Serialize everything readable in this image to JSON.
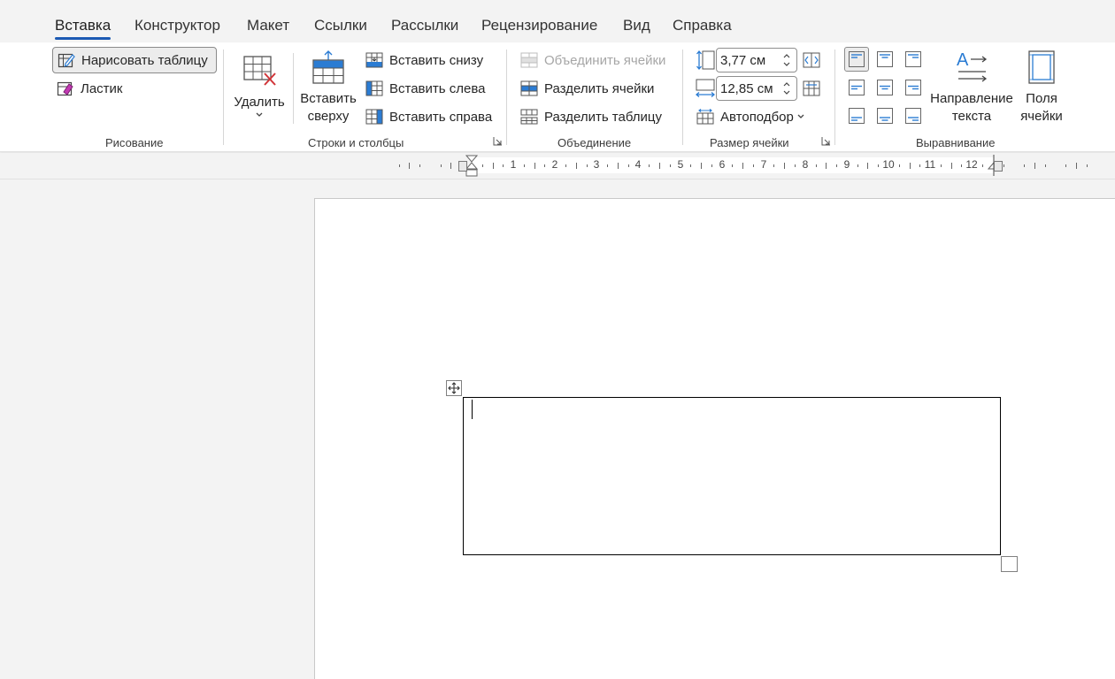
{
  "tabs": [
    "Вставка",
    "Конструктор",
    "Макет",
    "Ссылки",
    "Рассылки",
    "Рецензирование",
    "Вид",
    "Справка"
  ],
  "drawing": {
    "draw_table": "Нарисовать таблицу",
    "eraser": "Ластик",
    "group": "Рисование"
  },
  "rows_cols": {
    "delete": "Удалить",
    "insert_above_1": "Вставить",
    "insert_above_2": "сверху",
    "insert_below": "Вставить снизу",
    "insert_left": "Вставить слева",
    "insert_right": "Вставить справа",
    "group": "Строки и столбцы"
  },
  "merge": {
    "merge_cells": "Объединить ячейки",
    "split_cells": "Разделить ячейки",
    "split_table": "Разделить таблицу",
    "group": "Объединение"
  },
  "cell_size": {
    "height": "3,77 см",
    "width": "12,85 см",
    "autofit": "Автоподбор",
    "group": "Размер ячейки"
  },
  "alignment": {
    "text_direction_1": "Направление",
    "text_direction_2": "текста",
    "cell_margins_1": "Поля",
    "cell_margins_2": "ячейки",
    "group": "Выравнивание"
  },
  "ruler": {
    "numbers": [
      "1",
      "2",
      "3",
      "4",
      "5",
      "6",
      "7",
      "8",
      "9",
      "10",
      "11",
      "12"
    ]
  },
  "colors": {
    "accent": "#1c5ab3",
    "icon_blue": "#2b7cd3",
    "icon_red": "#d13438",
    "disabled": "#a6a6a6"
  }
}
